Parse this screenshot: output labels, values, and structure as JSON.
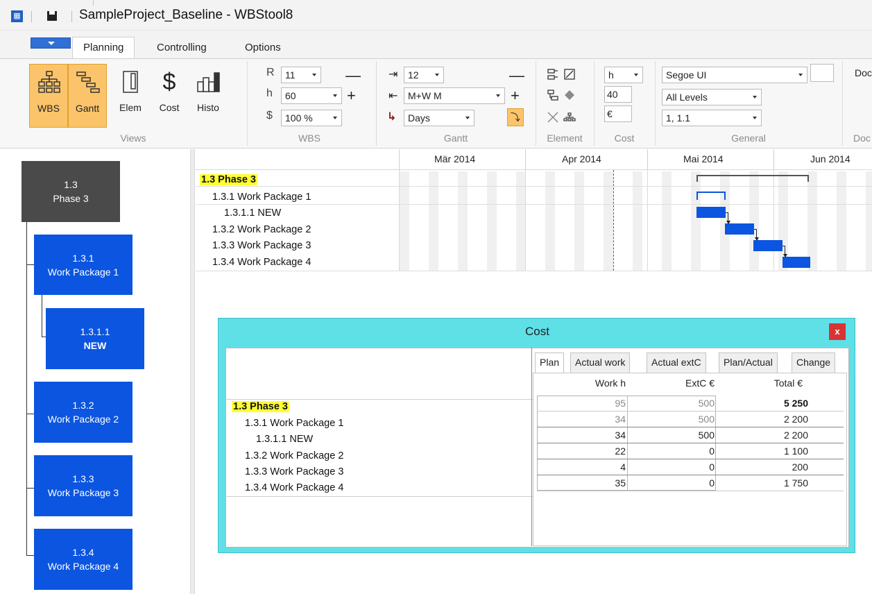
{
  "window": {
    "title": "SampleProject_Baseline - WBStool8",
    "app_icon": "grid-app-icon"
  },
  "ribbon": {
    "tabs": [
      "Planning",
      "Controlling",
      "Options"
    ],
    "views": {
      "buttons": [
        "WBS",
        "Gantt",
        "Elem",
        "Cost",
        "Histo"
      ],
      "group_label": "Views"
    },
    "wbs": {
      "r_label": "R",
      "r_value": "11",
      "h_label": "h",
      "h_value": "60",
      "cur_label": "$",
      "cur_value": "100 %",
      "minus": "—",
      "plus": "+",
      "group_label": "WBS"
    },
    "gantt": {
      "indent_value": "12",
      "scale_value": "M+W M",
      "unit_value": "Days",
      "minus": "—",
      "plus": "+",
      "group_label": "Gantt"
    },
    "element": {
      "group_label": "Element"
    },
    "cost": {
      "unit": "h",
      "value": "40",
      "currency": "€",
      "group_label": "Cost"
    },
    "general": {
      "font": "Segoe UI",
      "levels": "All Levels",
      "numbering": "1, 1.1",
      "group_label": "General"
    },
    "doc": {
      "label_top": "Doc",
      "group_label": "Doc"
    }
  },
  "wbs_tree": [
    {
      "code": "1.3",
      "name": "Phase 3"
    },
    {
      "code": "1.3.1",
      "name": "Work Package 1"
    },
    {
      "code": "1.3.1.1",
      "name": "NEW"
    },
    {
      "code": "1.3.2",
      "name": "Work Package 2"
    },
    {
      "code": "1.3.3",
      "name": "Work Package 3"
    },
    {
      "code": "1.3.4",
      "name": "Work Package 4"
    }
  ],
  "gantt": {
    "months": [
      "Mär 2014",
      "Apr 2014",
      "Mai 2014",
      "Jun 2014"
    ],
    "rows": [
      "1.3 Phase 3",
      "1.3.1 Work Package 1",
      "1.3.1.1 NEW",
      "1.3.2 Work Package 2",
      "1.3.3 Work Package 3",
      "1.3.4 Work Package 4"
    ]
  },
  "cost_dialog": {
    "title": "Cost",
    "close": "x",
    "tabs": [
      "Plan",
      "Actual work",
      "Actual extC",
      "Plan/Actual",
      "Change"
    ],
    "columns": [
      "Work h",
      "ExtC €",
      "Total €"
    ],
    "rows": [
      {
        "name": "1.3 Phase 3",
        "work": "95",
        "extc": "500",
        "total": "5 250"
      },
      {
        "name": "1.3.1 Work Package 1",
        "work": "34",
        "extc": "500",
        "total": "2 200"
      },
      {
        "name": "1.3.1.1 NEW",
        "work": "34",
        "extc": "500",
        "total": "2 200"
      },
      {
        "name": "1.3.2 Work Package 2",
        "work": "22",
        "extc": "0",
        "total": "1 100"
      },
      {
        "name": "1.3.3 Work Package 3",
        "work": "4",
        "extc": "0",
        "total": "200"
      },
      {
        "name": "1.3.4 Work Package 4",
        "work": "35",
        "extc": "0",
        "total": "1 750"
      }
    ]
  },
  "colors": {
    "accent": "#0b55e0",
    "highlight": "#ffff33",
    "active_view": "#fbc46a",
    "dialog_bg": "#5fe0e6",
    "close": "#d83434"
  }
}
